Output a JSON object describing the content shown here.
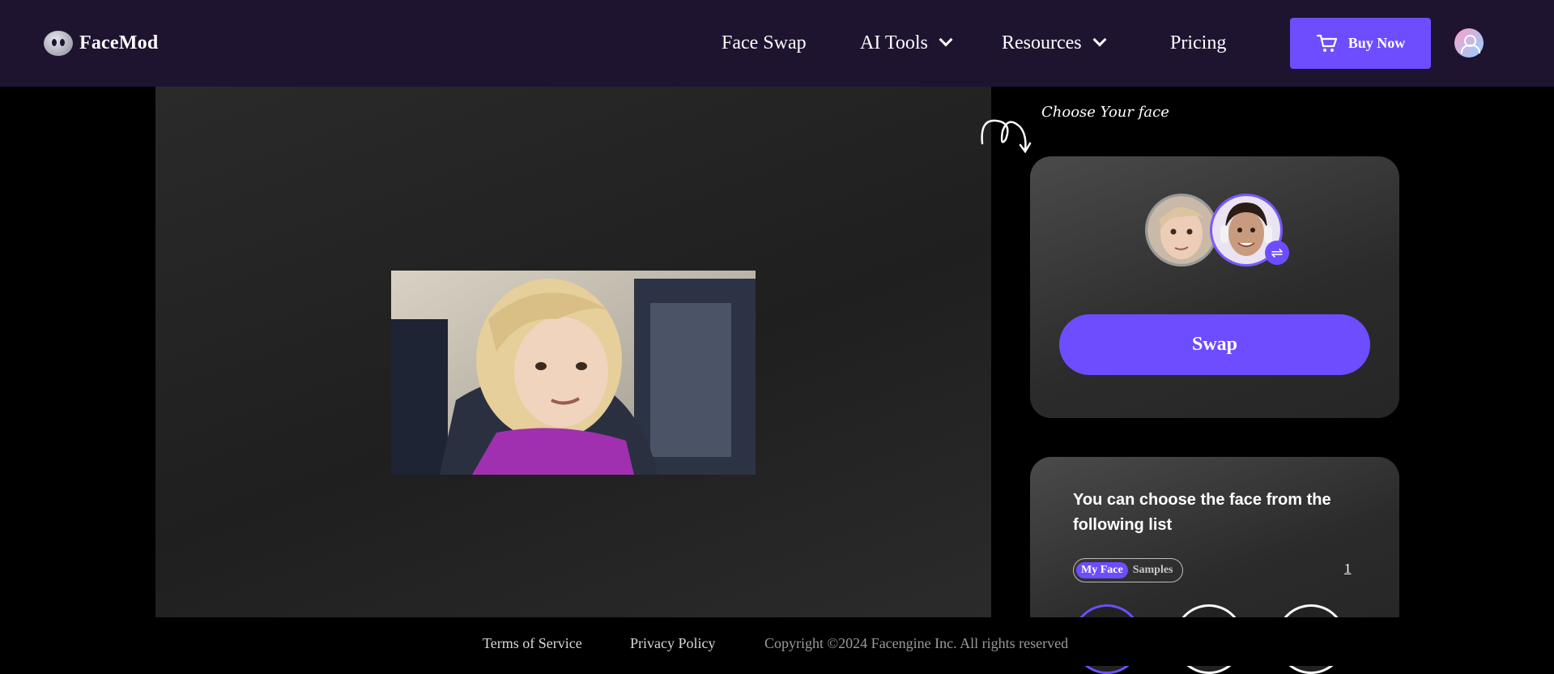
{
  "header": {
    "brand": "FaceMod",
    "nav": [
      "Face Swap",
      "AI Tools",
      "Resources",
      "Pricing"
    ],
    "buy_label": "Buy Now"
  },
  "panel": {
    "choose_label": "Choose Your face",
    "swap_label": "Swap",
    "list_title": "You can choose the face from the following list",
    "tab_my_face": "My Face",
    "tab_samples": "Samples",
    "page_number": "1"
  },
  "footer": {
    "terms": "Terms of Service",
    "privacy": "Privacy Policy",
    "copyright": "Copyright ©2024  Facengine Inc. All rights reserved"
  },
  "colors": {
    "accent": "#6d4dff",
    "header_bg": "#1e1430"
  }
}
